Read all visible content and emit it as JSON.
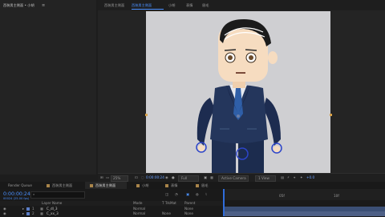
{
  "project_panel": {
    "title": "西装男主侧面 • 小胡",
    "menu_icon": "≡"
  },
  "comp_tabs": [
    {
      "label": "西装男主侧面",
      "active": false
    },
    {
      "label": "西装男主侧面",
      "active": true
    },
    {
      "label": "小胡",
      "active": false
    },
    {
      "label": "表情",
      "active": false
    },
    {
      "label": "眉毛",
      "active": false
    }
  ],
  "viewer_toolbar": {
    "zoom": "25%",
    "timecode": "0:00:00:24",
    "resolution": "Full",
    "camera": "Active Camera",
    "views": "1 View",
    "exposure": "+0.0"
  },
  "timeline": {
    "tabs": [
      {
        "label": "Render Queue"
      },
      {
        "label": "西装男主侧面"
      },
      {
        "label": "西装男主侧面",
        "active": true
      },
      {
        "label": "小胡"
      },
      {
        "label": "表情"
      },
      {
        "label": "眉毛"
      }
    ],
    "timecode": "0:00:00:24",
    "fps_note": "00024 (25.00 fps)",
    "columns": {
      "layer_name": "Layer Name",
      "mode": "Mode",
      "trkmat": "T TrkMat",
      "parent": "Parent"
    },
    "layers": [
      {
        "num": "1",
        "name": "C_dl_3",
        "mode": "Normal",
        "trkmat": "",
        "parent": "None"
      },
      {
        "num": "2",
        "name": "C_xx_3",
        "mode": "Normal",
        "trkmat": "None",
        "parent": "None"
      }
    ],
    "ruler_marks": [
      "",
      "05f",
      "10f"
    ]
  },
  "colors": {
    "accent": "#4a90ff",
    "suit": "#1f2f52",
    "tie": "#2f5fa8",
    "skin": "#f6dcc0"
  }
}
